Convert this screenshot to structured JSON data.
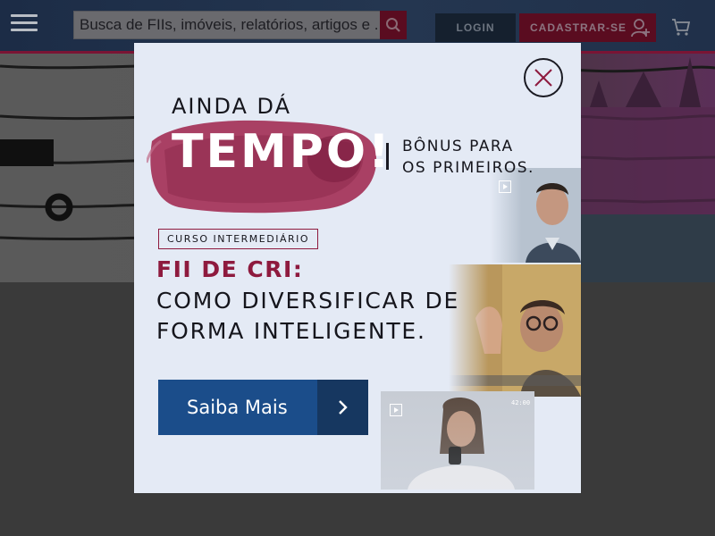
{
  "header": {
    "search_placeholder": "Busca de FIIs, imóveis, relatórios, artigos e ...",
    "login_label": "LOGIN",
    "signup_label": "CADASTRAR-SE"
  },
  "modal": {
    "headline_small": "AINDA DÁ",
    "headline_big": "TEMPO!",
    "bonus_line1": "BÔNUS PARA",
    "bonus_line2": "OS PRIMEIROS.",
    "tag": "CURSO INTERMEDIÁRIO",
    "course_title": "FII DE CRI:",
    "course_sub_line1": "COMO DIVERSIFICAR DE",
    "course_sub_line2": "FORMA INTELIGENTE.",
    "cta_label": "Saiba Mais",
    "thumb3_time": "42:00"
  },
  "colors": {
    "accent": "#8e1a3e",
    "cta_blue": "#1b4d8a",
    "cta_dark": "#163760",
    "modal_bg": "#e4eaf5"
  },
  "icons": {
    "menu": "hamburger-icon",
    "search": "search-icon",
    "user": "add-user-icon",
    "cart": "cart-icon",
    "close": "close-icon",
    "cta": "chevron-right-icon",
    "play": "play-icon"
  }
}
